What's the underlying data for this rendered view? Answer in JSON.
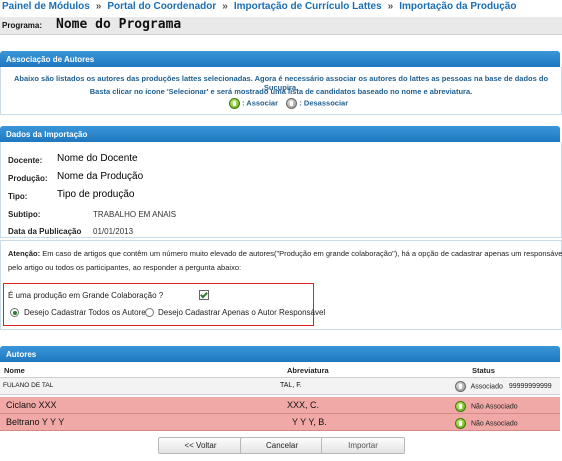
{
  "breadcrumb": {
    "items": [
      "Painel de Módulos",
      "Portal do Coordenador",
      "Importação de Currículo Lattes",
      "Importação da Produção"
    ],
    "separator": "»"
  },
  "program": {
    "label": "Programa:",
    "name": "Nome do Programa"
  },
  "association": {
    "header": "Associação de Autores",
    "line1": "Abaixo são listados os autores das produções lattes selecionadas. Agora é necessário associar os autores do lattes as pessoas na base de dados do Sucupira.",
    "line2": "Basta clicar no ícone 'Selecionar' e será mostrado uma lista de candidatos baseado no nome e abreviatura.",
    "legend_associate": ": Associar",
    "legend_disassociate": ": Desassociar"
  },
  "import_data": {
    "header": "Dados da Importação",
    "fields": [
      {
        "label": "Docente:",
        "value": "Nome do Docente"
      },
      {
        "label": "Produção:",
        "value": "Nome da Produção"
      },
      {
        "label": "Tipo:",
        "value": "Tipo de produção"
      },
      {
        "label": "Subtipo:",
        "value": "TRABALHO EM ANAIS"
      },
      {
        "label": "Data da Publicação",
        "value": "01/01/2013"
      }
    ]
  },
  "attention": {
    "title": "Atenção:",
    "text": "Em caso de artigos que contêm um número muito elevado de autores(\"Produção em grande colaboração\"), há a opção de cadastrar apenas um responsável pelo artigo ou todos os participantes, ao responder a pergunta abaixo:",
    "question": "É uma produção em Grande Colaboração ?",
    "option_all": "Desejo Cadastrar Todos os Autores",
    "option_one": "Desejo Cadastrar Apenas o Autor Responsável"
  },
  "authors": {
    "header": "Autores",
    "columns": [
      "Nome",
      "Abreviatura",
      "Status"
    ],
    "rows": [
      {
        "name": "FULANO DE TAL",
        "abbrev": "TAL, F.",
        "status": "Associado",
        "extra": "99999999999"
      },
      {
        "name": "Ciclano XXX",
        "abbrev": "XXX, C.",
        "status": "Não Associado"
      },
      {
        "name": "Beltrano Y Y Y",
        "abbrev": "Y Y Y, B.",
        "status": "Não Associado"
      }
    ]
  },
  "buttons": {
    "back": "<< Voltar",
    "cancel": "Cancelar",
    "import": "Importar"
  },
  "colors": {
    "header_blue": "#2a86cc",
    "link_blue": "#1a6fb5",
    "error_row": "#f1a9a7",
    "frame_red": "#dd2222"
  }
}
